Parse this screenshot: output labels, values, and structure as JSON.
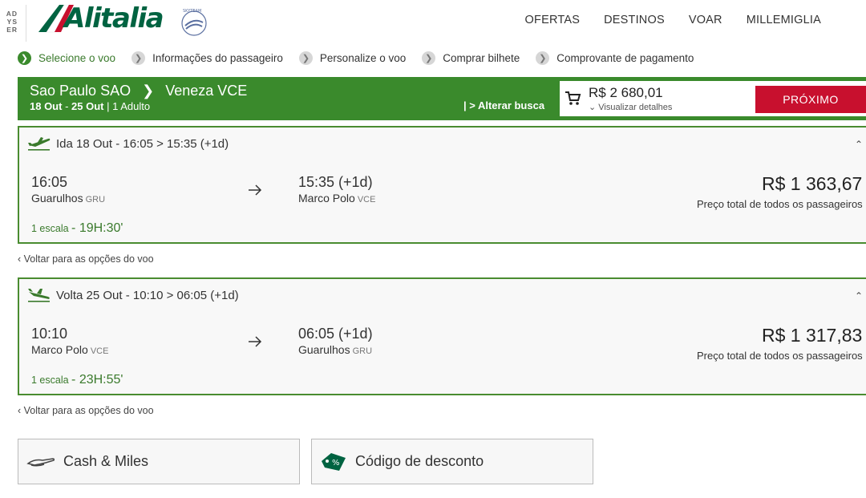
{
  "header": {
    "partner_lines": [
      "AD",
      "YS",
      "ER"
    ],
    "logo": "Alitalia",
    "skyteam": "SKYTEAM",
    "nav": [
      "OFERTAS",
      "DESTINOS",
      "VOAR",
      "MILLEMIGLIA"
    ]
  },
  "steps": [
    {
      "label": "Selecione o voo",
      "active": true
    },
    {
      "label": "Informações do passageiro",
      "active": false
    },
    {
      "label": "Personalize o voo",
      "active": false
    },
    {
      "label": "Comprar bilhete",
      "active": false
    },
    {
      "label": "Comprovante de pagamento",
      "active": false
    }
  ],
  "route": {
    "from": "Sao Paulo SAO",
    "to": "Veneza VCE",
    "date_out": "18 Out",
    "date_sep": " - ",
    "date_back": "25 Out",
    "pax": " | 1 Adulto",
    "alter_label": "| > Alterar busca",
    "total": "R$ 2 680,01",
    "details_label": "Visualizar detalhes",
    "next_label": "PRÓXIMO"
  },
  "outbound": {
    "header": "Ida 18 Out - 16:05 > 15:35 (+1d)",
    "dep_time": "16:05",
    "dep_city": "Guarulhos",
    "dep_code": "GRU",
    "arr_time": "15:35 (+1d)",
    "arr_city": "Marco Polo",
    "arr_code": "VCE",
    "price": "R$ 1 363,67",
    "price_note": "Preço total de todos os passageiros",
    "stops": "1 escala",
    "duration": "19H:30'"
  },
  "return": {
    "header": "Volta 25 Out - 10:10 > 06:05 (+1d)",
    "dep_time": "10:10",
    "dep_city": "Marco Polo",
    "dep_code": "VCE",
    "arr_time": "06:05 (+1d)",
    "arr_city": "Guarulhos",
    "arr_code": "GRU",
    "price": "R$ 1 317,83",
    "price_note": "Preço total de todos os passageiros",
    "stops": "1 escala",
    "duration": "23H:55'"
  },
  "back_link": "Voltar para as opções do voo",
  "promos": {
    "cash_miles": "Cash & Miles",
    "discount_code": "Código de desconto"
  },
  "colors": {
    "brand_green": "#006341",
    "bar_green": "#3a8a2c",
    "accent_red": "#c8102e"
  }
}
